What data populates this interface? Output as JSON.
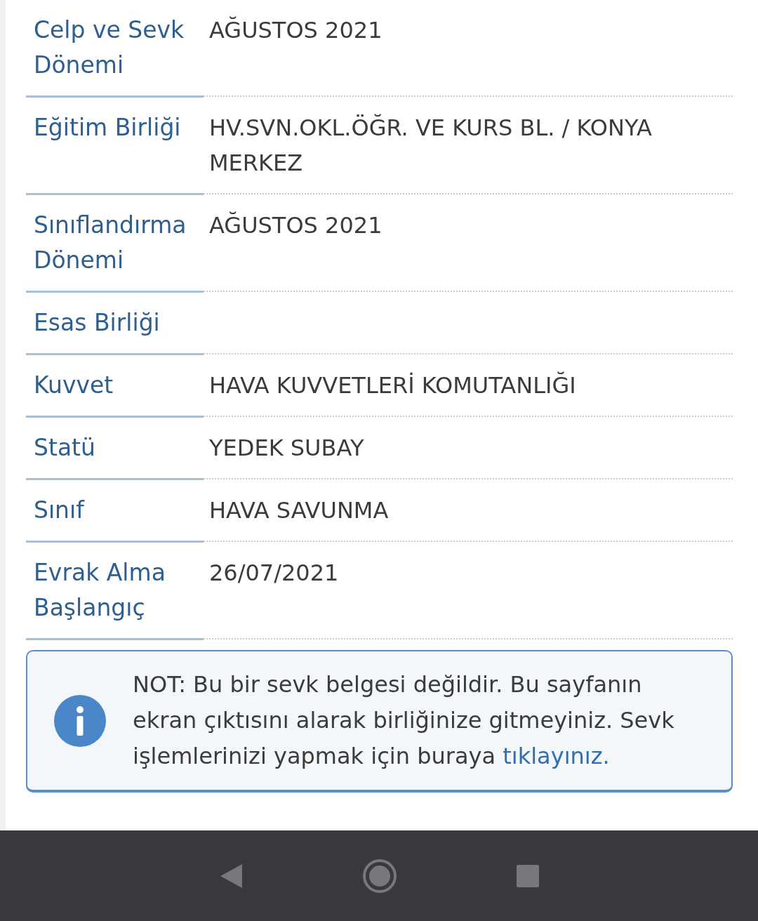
{
  "details": [
    {
      "label": "Celp ve Sevk Dönemi",
      "value": "AĞUSTOS 2021"
    },
    {
      "label": "Eğitim Birliği",
      "value": "HV.SVN.OKL.ÖĞR. VE KURS BL. / KONYA MERKEZ"
    },
    {
      "label": "Sınıflandırma Dönemi",
      "value": "AĞUSTOS 2021"
    },
    {
      "label": "Esas Birliği"
    },
    {
      "label": "Kuvvet",
      "value": "HAVA KUVVETLERİ KOMUTANLIĞI"
    },
    {
      "label": "Statü",
      "value": "YEDEK SUBAY"
    },
    {
      "label": "Sınıf",
      "value": "HAVA SAVUNMA"
    },
    {
      "label": "Evrak Alma Başlangıç",
      "value": "26/07/2021"
    }
  ],
  "note": {
    "text": "NOT: Bu bir sevk belgesi değildir. Bu sayfanın ekran çıktısını alarak birliğinize gitmeyiniz. Sevk işlemlerinizi yapmak için buraya",
    "link": "tıklayınız."
  }
}
